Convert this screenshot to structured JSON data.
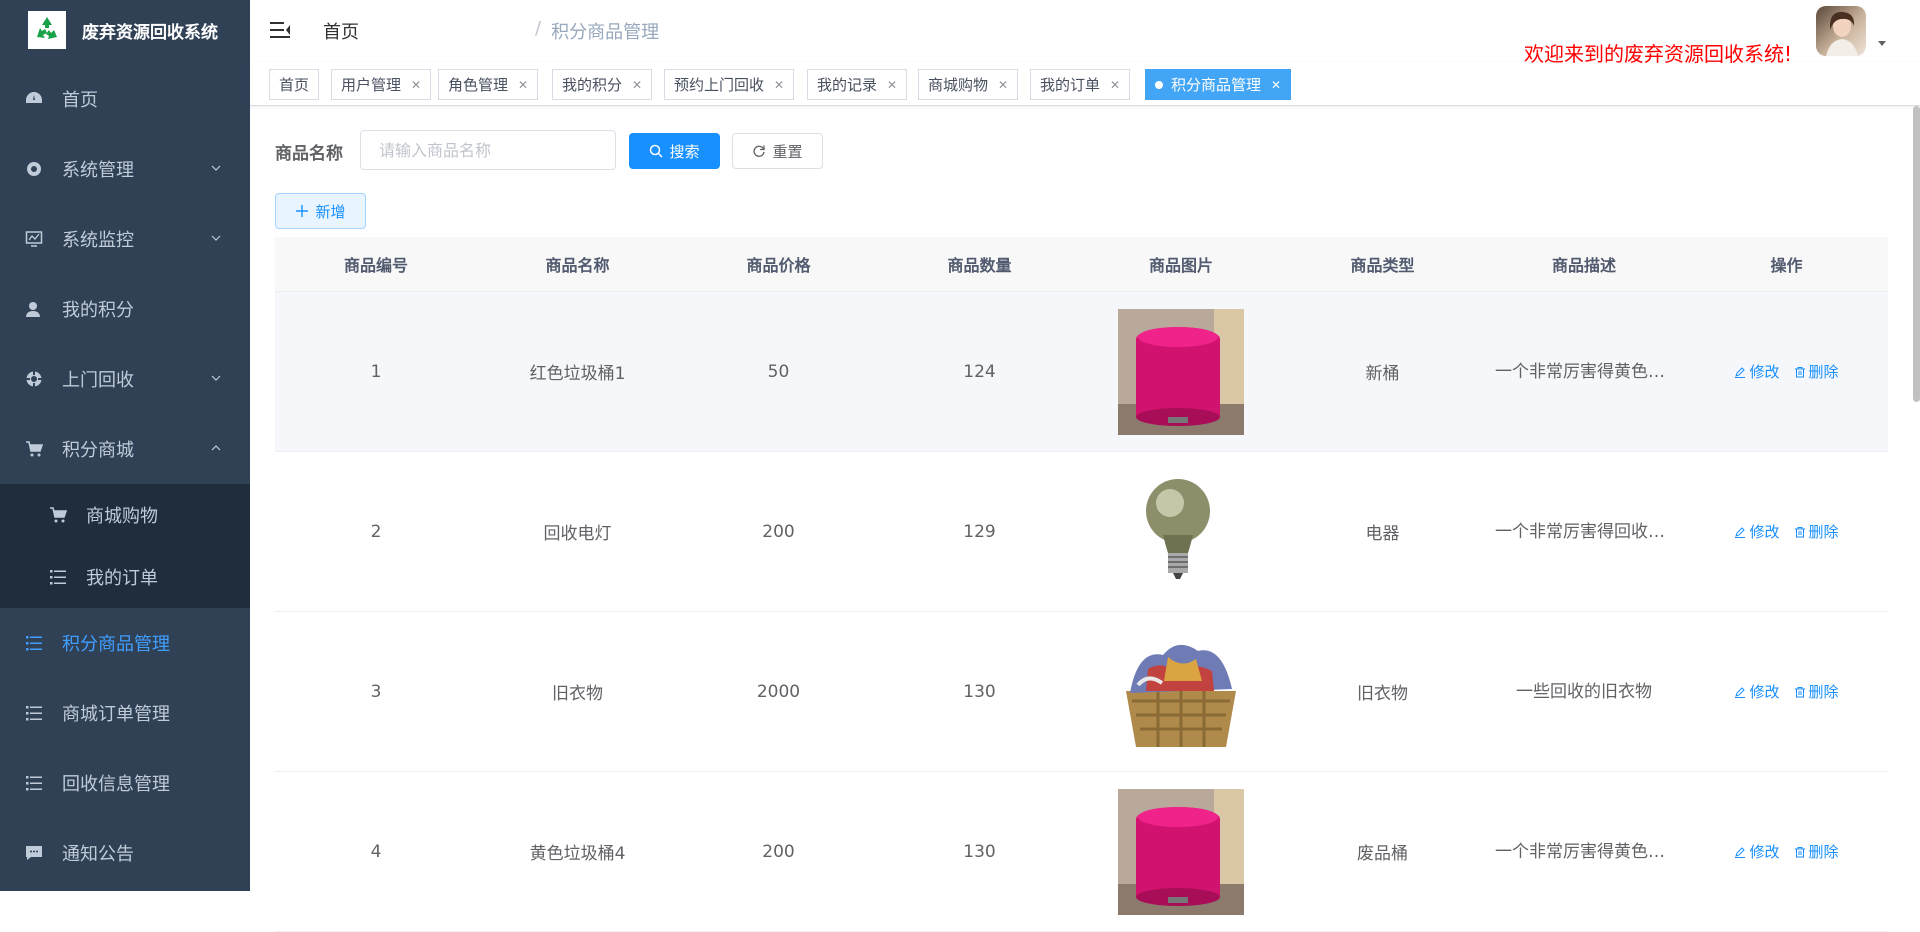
{
  "app": {
    "title": "废弃资源回收系统"
  },
  "sidebar": {
    "items": [
      {
        "label": "首页",
        "icon": "dashboard-icon"
      },
      {
        "label": "系统管理",
        "icon": "gear-icon"
      },
      {
        "label": "系统监控",
        "icon": "monitor-icon"
      },
      {
        "label": "我的积分",
        "icon": "user-icon"
      },
      {
        "label": "上门回收",
        "icon": "recycle-icon"
      },
      {
        "label": "积分商城",
        "icon": "cart-icon"
      },
      {
        "label": "商城购物",
        "icon": "cart-icon"
      },
      {
        "label": "我的订单",
        "icon": "list-icon"
      },
      {
        "label": "积分商品管理",
        "icon": "list-icon"
      },
      {
        "label": "商城订单管理",
        "icon": "list-icon"
      },
      {
        "label": "回收信息管理",
        "icon": "list-icon"
      },
      {
        "label": "通知公告",
        "icon": "message-icon"
      }
    ]
  },
  "header": {
    "breadcrumb": [
      "首页",
      "积分商品管理"
    ],
    "welcome": "欢迎来到的废弃资源回收系统!"
  },
  "tags": [
    "首页",
    "用户管理",
    "角色管理",
    "我的积分",
    "预约上门回收",
    "我的记录",
    "商城购物",
    "我的订单",
    "积分商品管理"
  ],
  "search": {
    "label": "商品名称",
    "placeholder": "请输入商品名称",
    "search_label": "搜索",
    "reset_label": "重置",
    "add_label": "新增"
  },
  "table": {
    "columns": [
      "商品编号",
      "商品名称",
      "商品价格",
      "商品数量",
      "商品图片",
      "商品类型",
      "商品描述",
      "操作"
    ],
    "rows": [
      {
        "id": "1",
        "name": "红色垃圾桶1",
        "price": "50",
        "qty": "124",
        "image": "pink-trash-can",
        "type": "新桶",
        "desc": "一个非常厉害得黄色垃圾桶"
      },
      {
        "id": "2",
        "name": "回收电灯",
        "price": "200",
        "qty": "129",
        "image": "light-bulb",
        "type": "电器",
        "desc": "一个非常厉害得回收电灯"
      },
      {
        "id": "3",
        "name": "旧衣物",
        "price": "2000",
        "qty": "130",
        "image": "clothes-basket",
        "type": "旧衣物",
        "desc": "一些回收的旧衣物"
      },
      {
        "id": "4",
        "name": "黄色垃圾桶4",
        "price": "200",
        "qty": "130",
        "image": "pink-trash-can",
        "type": "废品桶",
        "desc": "一个非常厉害得黄色垃圾桶"
      }
    ],
    "edit_label": "修改",
    "delete_label": "删除"
  },
  "colors": {
    "sidebar_bg": "#304156",
    "submenu_bg": "#1f2d3d",
    "primary": "#1890ff",
    "active_tag": "#42a5f5",
    "welcome": "#ff0000"
  }
}
